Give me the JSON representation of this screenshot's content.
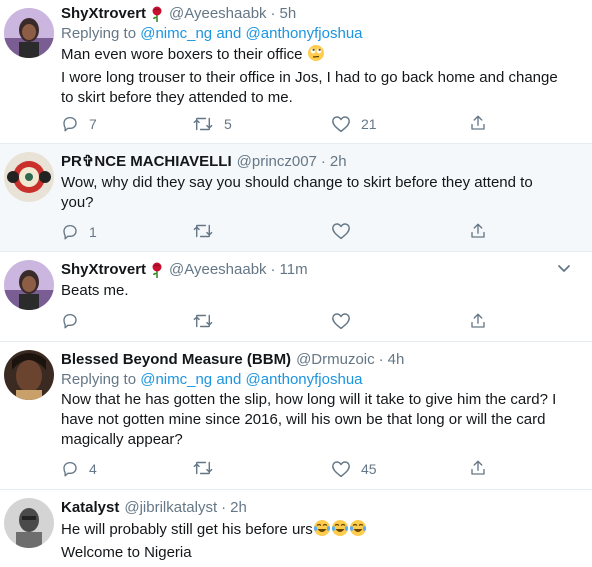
{
  "tweets": [
    {
      "name": "ShyXtrovert",
      "handle": "@Ayeeshaabk",
      "dot": "·",
      "time": "5h",
      "reply_prefix": "Replying to",
      "mention1": "@nimc_ng",
      "and": "and",
      "mention2": "@anthonyfjoshua",
      "lines": [
        "Man even wore boxers to their office",
        "I wore long trouser to their office in Jos, I had to go back home and change",
        "to skirt before they attended to me."
      ],
      "replies": "7",
      "retweets": "5",
      "likes": "21"
    },
    {
      "name": "PR✞NCE MACHIAVELLI",
      "handle": "@princz007",
      "dot": "·",
      "time": "2h",
      "lines": [
        "Wow, why did they say you should change to skirt before they attend to",
        "you?"
      ],
      "replies": "1",
      "retweets": "",
      "likes": ""
    },
    {
      "name": "ShyXtrovert",
      "handle": "@Ayeeshaabk",
      "dot": "·",
      "time": "11m",
      "lines": [
        "Beats me."
      ],
      "replies": "",
      "retweets": "",
      "likes": ""
    },
    {
      "name": "Blessed Beyond Measure (BBM)",
      "handle": "@Drmuzoic",
      "dot": "·",
      "time": "4h",
      "reply_prefix": "Replying to",
      "mention1": "@nimc_ng",
      "and": "and",
      "mention2": "@anthonyfjoshua",
      "lines": [
        "Now that he has gotten the slip, how long will it take to give him the card? I",
        "have not gotten mine since 2016, will his own be that long or will the card",
        "magically appear?"
      ],
      "replies": "4",
      "retweets": "",
      "likes": "45"
    },
    {
      "name": "Katalyst",
      "handle": "@jibrilkatalyst",
      "dot": "·",
      "time": "2h",
      "lines": [
        "He will probably still get his before urs",
        "Welcome to Nigeria"
      ]
    }
  ],
  "icons": {
    "reply": "reply-icon",
    "retweet": "retweet-icon",
    "like": "heart-icon",
    "share": "share-icon",
    "rose": "rose-emoji-icon",
    "rolling_eyes": "rolling-eyes-emoji-icon",
    "tears_of_joy": "tears-of-joy-emoji-icon",
    "caret": "chevron-down-icon"
  },
  "colors": {
    "link": "#1b95e0",
    "secondary": "#657786",
    "highlight_bg": "#f5f8fa",
    "divider": "#e6ecf0"
  }
}
